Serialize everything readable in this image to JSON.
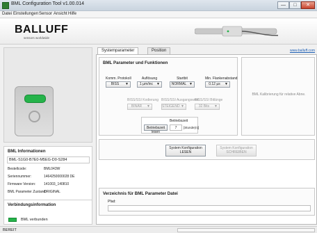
{
  "window": {
    "title": "BML Configuration Tool v1.00.014",
    "min_label": "—",
    "max_label": "□",
    "close_label": "✕"
  },
  "menu": [
    "Datei",
    "Einstellungen",
    "Sensor",
    "Ansicht",
    "Hilfe"
  ],
  "brand": {
    "name": "BALLUFF",
    "tagline": "sensors worldwide"
  },
  "tabs": [
    "Systemparameter",
    "Position"
  ],
  "link": "www.balluff.com",
  "params": {
    "title": "BML Parameter und Funktionen",
    "row1": [
      {
        "label": "Komm. Protokoll",
        "value": "BISS"
      },
      {
        "label": "Auflösung",
        "value": "1 µm/inc"
      },
      {
        "label": "Startbit",
        "value": "NORMAL"
      },
      {
        "label": "Min. Flankenabstand",
        "value": "0.12 µs"
      }
    ],
    "row2": [
      {
        "label": "BISS/SSI Kodierung",
        "value": "BINÄR"
      },
      {
        "label": "BISS/SSI Ausgangswert",
        "value": "STEIGEND"
      },
      {
        "label": "BISS/SSI Bitlänge",
        "value": "32 Bits"
      }
    ],
    "runtime": {
      "label": "Betriebszeit",
      "button": "Betriebszeit lesen",
      "value": "7",
      "unit": "[Stunde(n)]"
    },
    "side_note": "BML Kalibrierung für relative Abne."
  },
  "config": {
    "read_button": "System Konfiguration LESEN",
    "write_button": "System Konfiguration SCHREIBEN"
  },
  "directory": {
    "title": "Verzeichnis für BML Parameter Datei",
    "path_label": "Pfad:",
    "path_value": ""
  },
  "info": {
    "title": "BML Informationen",
    "code": "BML-S1G0-B7E0-M5EG-D0-S284",
    "rows": [
      {
        "label": "Bestellcode:",
        "value": "BML043W"
      },
      {
        "label": "Seriennummer:",
        "value": "1464250000028 DE"
      },
      {
        "label": "Firmware Version:",
        "value": "141003_140810"
      },
      {
        "label": "BML Parameter Zustand:",
        "value": "ORIGINAL"
      }
    ]
  },
  "connection": {
    "title": "Verbindungsinformation",
    "status": "BML verbunden",
    "led_color": "#25b34a"
  },
  "status": {
    "text": "BEREIT"
  },
  "colors": {
    "accent_green": "#25b34a",
    "link_blue": "#1d5fb5"
  }
}
